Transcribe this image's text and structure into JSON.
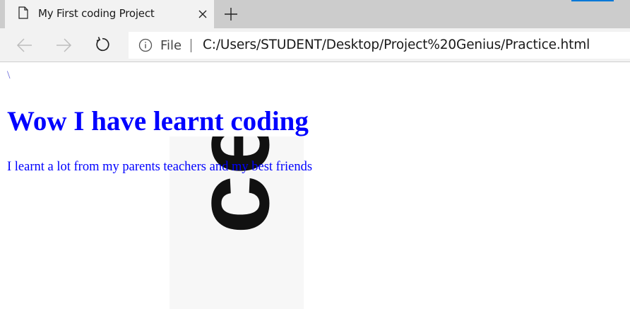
{
  "tab": {
    "title": "My First coding Project",
    "icon": "page-icon",
    "close_icon": "close-icon"
  },
  "toolbar": {
    "new_tab_icon": "plus-icon",
    "back_icon": "back-arrow-icon",
    "forward_icon": "forward-arrow-icon",
    "refresh_icon": "refresh-icon"
  },
  "address_bar": {
    "info_icon": "info-icon",
    "scheme_label": "File",
    "separator": "|",
    "url": "C:/Users/STUDENT/Desktop/Project%20Genius/Practice.html"
  },
  "page": {
    "stray_char": "\\",
    "heading": "Wow I have learnt coding",
    "paragraph": "I learnt a lot from my parents teachers and my best friends",
    "background_image_text": "ce"
  },
  "colors": {
    "tabstrip": "#cccccc",
    "tab_active": "#f2f2f2",
    "navbar": "#f2f2f2",
    "address_bg": "#ffffff",
    "page_text": "#0000ff",
    "accent": "#0078d7"
  }
}
